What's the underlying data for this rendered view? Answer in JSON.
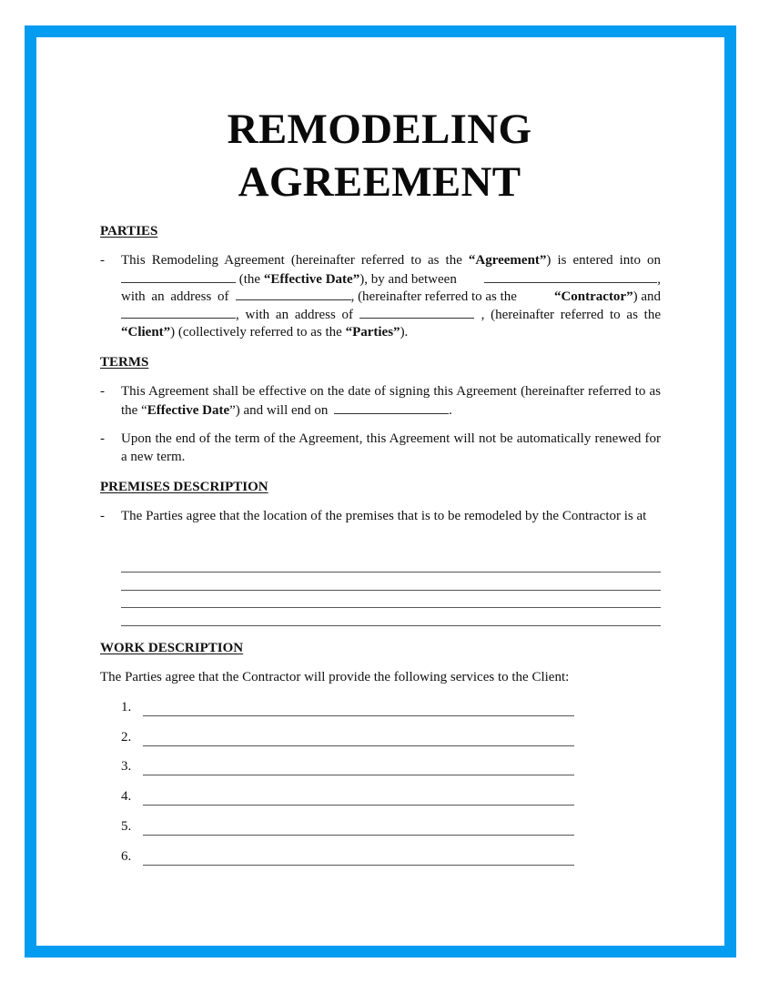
{
  "document": {
    "title_line1": "REMODELING",
    "title_line2": "AGREEMENT",
    "border_color": "#049CF0",
    "bullet_char": "-",
    "sections": {
      "parties": {
        "heading": "PARTIES",
        "p1_a": "This Remodeling Agreement (hereinafter referred to as the ",
        "p1_agreement": "“Agreement”",
        "p1_b": ") is entered into on",
        "p1_c": " (the ",
        "p1_effective": "“Effective Date”",
        "p1_d": "), by and between",
        "p1_e": ",",
        "p1_f": "with an address of",
        "p1_g": ", (hereinafter referred to as the ",
        "p1_contractor": "“Contractor”",
        "p1_h": ") and",
        "p1_i": ", with an address of",
        "p1_j": ", (hereinafter referred to as the",
        "p1_client": "“Client”",
        "p1_k": ") (collectively referred to as the ",
        "p1_parties": "“Parties”",
        "p1_l": ")."
      },
      "terms": {
        "heading": "TERMS",
        "b1_a": "This Agreement shall be effective on the date of signing this Agreement (hereinafter referred to as the “",
        "b1_effective": "Effective Date",
        "b1_b": "”) and will end on",
        "b1_c": ".",
        "b2": "Upon the end of the term of the Agreement, this Agreement will not be automatically renewed for a new term."
      },
      "premises": {
        "heading": "PREMISES DESCRIPTION",
        "b1": "The Parties agree that the location of the premises that is to be remodeled by the Contractor is at",
        "blank_line_count": 4
      },
      "work": {
        "heading": "WORK DESCRIPTION",
        "intro": "The Parties agree that the Contractor will provide the following services to the Client:",
        "items": [
          "1.",
          "2.",
          "3.",
          "4.",
          "5.",
          "6."
        ]
      }
    }
  }
}
